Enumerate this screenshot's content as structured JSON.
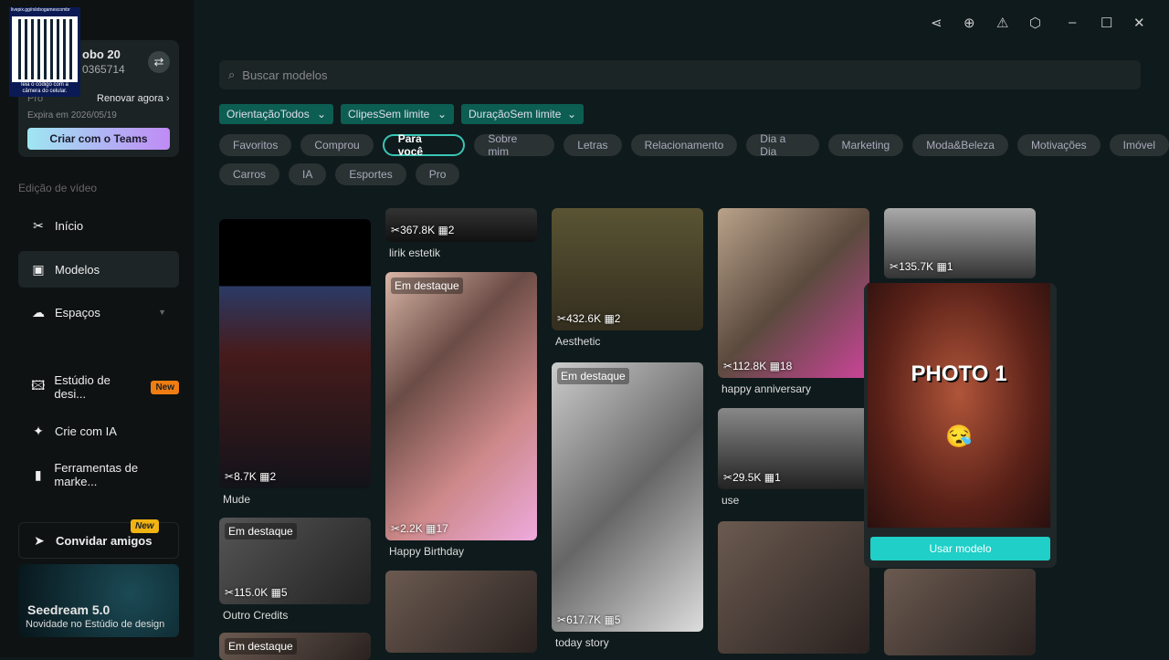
{
  "qr": {
    "url": "livepix.gg/rslobogamescombr",
    "caption": "leia o código com a câmera do celular."
  },
  "account": {
    "name": "obo 20",
    "id": "0365714",
    "plan": "Pro",
    "renew": "Renovar agora",
    "expires": "Expira em 2026/05/19",
    "teams_button": "Criar com o Teams"
  },
  "sidebar": {
    "section": "Edição de vídeo",
    "items": [
      {
        "label": "Início",
        "icon": "scissors-icon"
      },
      {
        "label": "Modelos",
        "icon": "template-icon"
      },
      {
        "label": "Espaços",
        "icon": "cloud-icon"
      },
      {
        "label": "Estúdio de desi...",
        "icon": "image-sparkle-icon",
        "badge": "New"
      },
      {
        "label": "Crie com IA",
        "icon": "sparkle-icon"
      },
      {
        "label": "Ferramentas de marke...",
        "icon": "marketing-icon"
      }
    ],
    "invite": {
      "label": "Convidar amigos",
      "badge": "New"
    },
    "promo": {
      "title": "Seedream 5.0",
      "subtitle": "Novidade no Estúdio de design"
    }
  },
  "search": {
    "placeholder": "Buscar modelos"
  },
  "filters": [
    "OrientaçãoTodos",
    "ClipesSem limite",
    "DuraçãoSem limite"
  ],
  "chips": [
    "Favoritos",
    "Comprou",
    "Para você",
    "Sobre mim",
    "Letras",
    "Relacionamento",
    "Dia a Dia",
    "Marketing",
    "Moda&Beleza",
    "Motivações",
    "Imóvel",
    "Carros",
    "IA",
    "Esportes",
    "Pro"
  ],
  "active_chip": "Para você",
  "featured_label": "Em destaque",
  "cards": [
    {
      "uses": "8.7K",
      "clips": "2",
      "title": "Mude"
    },
    {
      "uses": "115.0K",
      "clips": "5",
      "title": "Outro Credits"
    },
    {
      "uses": "367.8K",
      "clips": "2",
      "title": "lirik estetik"
    },
    {
      "uses": "2.2K",
      "clips": "17",
      "title": "Happy Birthday"
    },
    {
      "uses": "432.6K",
      "clips": "2",
      "title": "Aesthetic"
    },
    {
      "uses": "617.7K",
      "clips": "5",
      "title": "today story"
    },
    {
      "uses": "112.8K",
      "clips": "18",
      "title": "happy anniversary"
    },
    {
      "uses": "29.5K",
      "clips": "1",
      "title": "use"
    },
    {
      "uses": "135.7K",
      "clips": "1",
      "title": ""
    }
  ],
  "preview": {
    "text": "PHOTO 1",
    "button": "Usar modelo"
  },
  "colors": {
    "accent": "#1fcfc8",
    "filter": "#0d5e52",
    "badge": "#f07d12"
  }
}
